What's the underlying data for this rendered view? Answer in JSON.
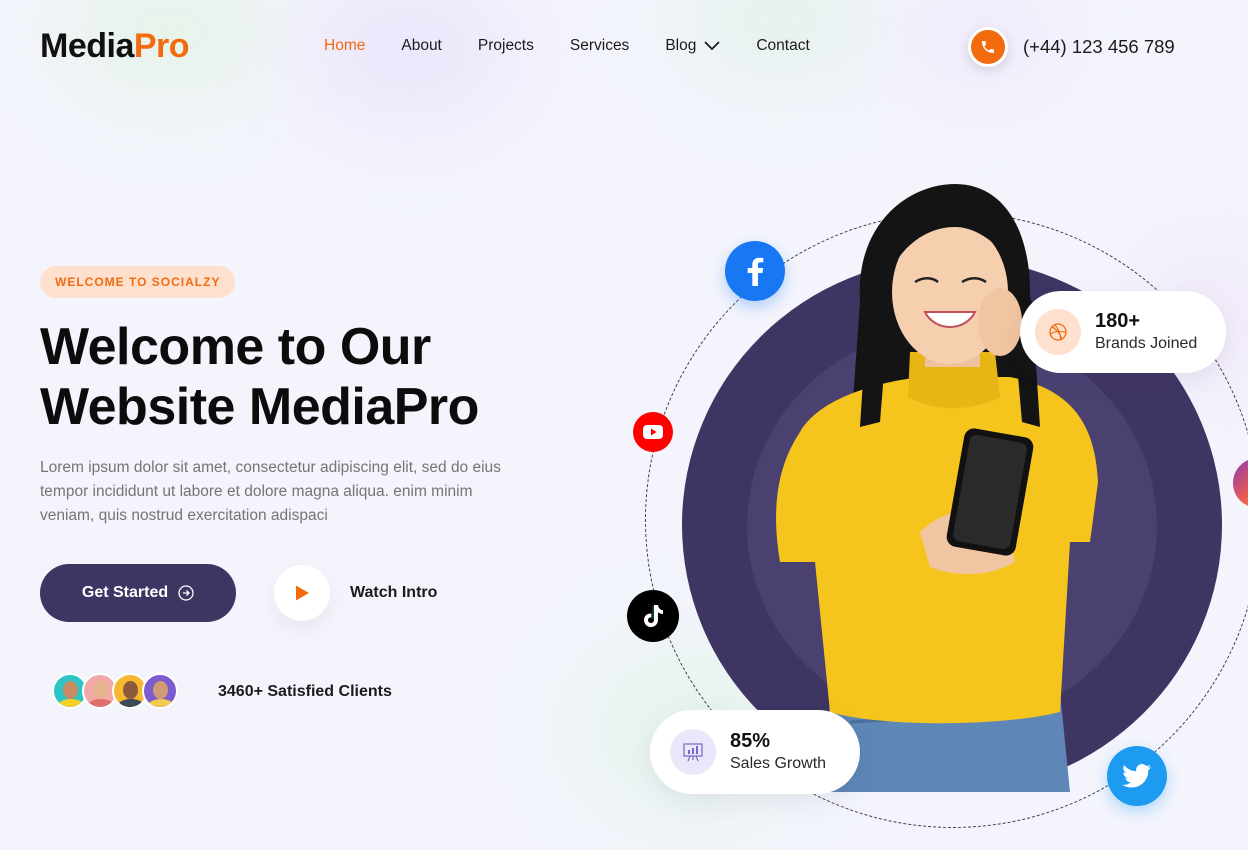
{
  "header": {
    "logo": {
      "part1": "Media",
      "part2": "Pro"
    },
    "nav": [
      {
        "label": "Home",
        "active": true
      },
      {
        "label": "About"
      },
      {
        "label": "Projects"
      },
      {
        "label": "Services"
      },
      {
        "label": "Blog",
        "has_dropdown": true
      },
      {
        "label": "Contact"
      }
    ],
    "phone": {
      "icon": "phone-icon",
      "number": "(+44) 123 456 789"
    }
  },
  "hero": {
    "badge": "WELCOME TO SOCIALZY",
    "title_line1": "Welcome to Our",
    "title_line2": "Website MediaPro",
    "description": "Lorem ipsum dolor sit amet, consectetur adipiscing elit, sed do eius tempor incididunt ut labore et dolore magna aliqua. enim minim veniam, quis nostrud exercitation adispaci",
    "cta_label": "Get Started",
    "watch_label": "Watch Intro",
    "clients_label": "3460+ Satisfied Clients"
  },
  "stats": {
    "brands": {
      "value": "180+",
      "label": "Brands Joined",
      "icon": "dribbble-icon"
    },
    "sales": {
      "value": "85%",
      "label": "Sales Growth",
      "icon": "chart-board-icon"
    }
  },
  "social_icons": [
    "facebook-icon",
    "youtube-icon",
    "tiktok-icon",
    "twitter-icon",
    "instagram-icon"
  ],
  "colors": {
    "accent": "#f26b0f",
    "primary": "#3f3562",
    "background": "#f3f4fc",
    "facebook": "#1877f2",
    "youtube": "#ff0000",
    "twitter": "#1d9bf0"
  }
}
